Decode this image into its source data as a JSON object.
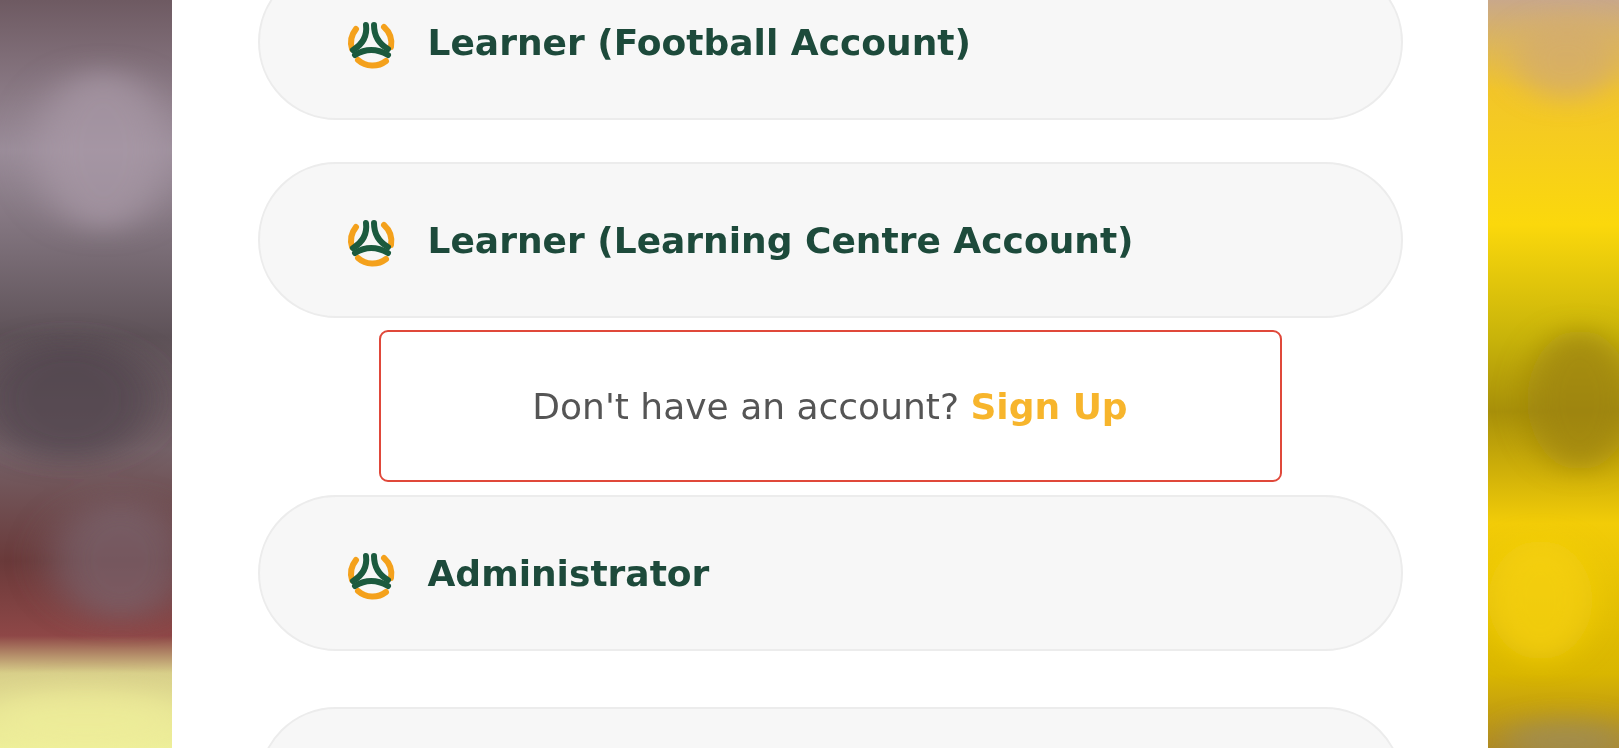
{
  "items": [
    {
      "kind": "role",
      "label": "Learner (Football Account)"
    },
    {
      "kind": "role",
      "label": "Learner (Learning Centre Account)"
    },
    {
      "kind": "signup",
      "prompt": "Don't have an account?",
      "link": "Sign Up",
      "highlighted": true
    },
    {
      "kind": "role",
      "label": "Administrator"
    }
  ]
}
